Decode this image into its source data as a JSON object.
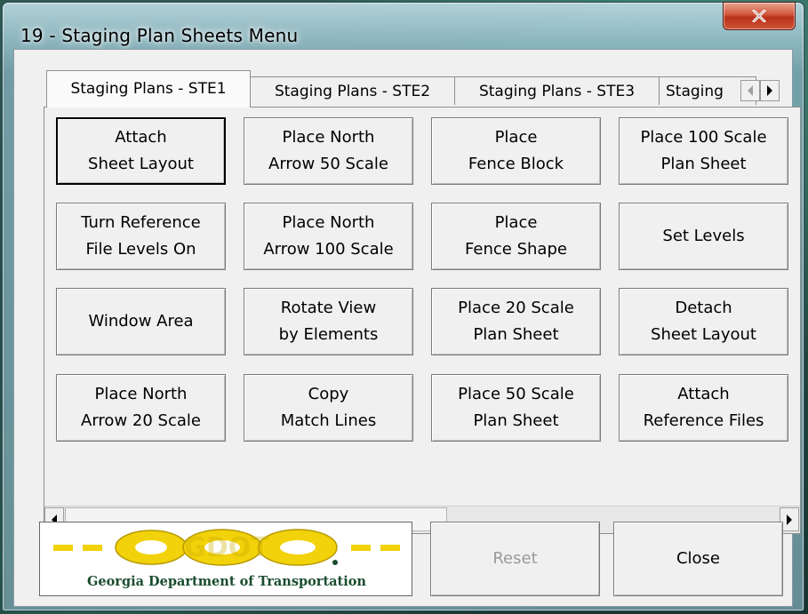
{
  "window": {
    "title": "19 - Staging Plan Sheets Menu",
    "close_icon": "close-icon"
  },
  "tabs": [
    {
      "label": "Staging Plans - STE1",
      "active": true
    },
    {
      "label": "Staging Plans - STE2",
      "active": false
    },
    {
      "label": "Staging Plans - STE3",
      "active": false
    },
    {
      "label": "Staging",
      "active": false
    }
  ],
  "buttons": [
    "Attach\nSheet Layout",
    "Place North\nArrow 50 Scale",
    "Place\nFence Block",
    "Place 100 Scale\nPlan Sheet",
    "Turn Reference\nFile Levels On",
    "Place North\nArrow 100 Scale",
    "Place\nFence Shape",
    "Set Levels",
    "Window Area",
    "Rotate View\nby Elements",
    "Place 20 Scale\nPlan Sheet",
    "Detach\nSheet Layout",
    "Place North\nArrow 20 Scale",
    "Copy\nMatch Lines",
    "Place 50 Scale\nPlan Sheet",
    "Attach\nReference Files"
  ],
  "footer": {
    "logo_text": "GDOT",
    "logo_caption": "Georgia Department of Transportation",
    "reset_label": "Reset",
    "close_label": "Close"
  },
  "colors": {
    "logo_yellow": "#f2d20a",
    "logo_green": "#1a4d2e",
    "close_red": "#c8432a"
  }
}
